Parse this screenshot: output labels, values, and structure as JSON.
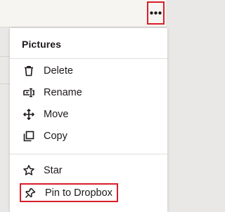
{
  "toolbar": {
    "more_icon": "more-horizontal-icon"
  },
  "menu": {
    "title": "Pictures",
    "items": [
      {
        "label": "Delete",
        "icon": "trash-icon"
      },
      {
        "label": "Rename",
        "icon": "rename-icon"
      },
      {
        "label": "Move",
        "icon": "move-arrows-icon"
      },
      {
        "label": "Copy",
        "icon": "copy-icon"
      },
      {
        "label": "Star",
        "icon": "star-icon"
      },
      {
        "label": "Pin to Dropbox",
        "icon": "pin-icon"
      }
    ]
  },
  "colors": {
    "highlight": "#d81e28",
    "text": "#1e1919",
    "background": "#e9e8e6"
  }
}
